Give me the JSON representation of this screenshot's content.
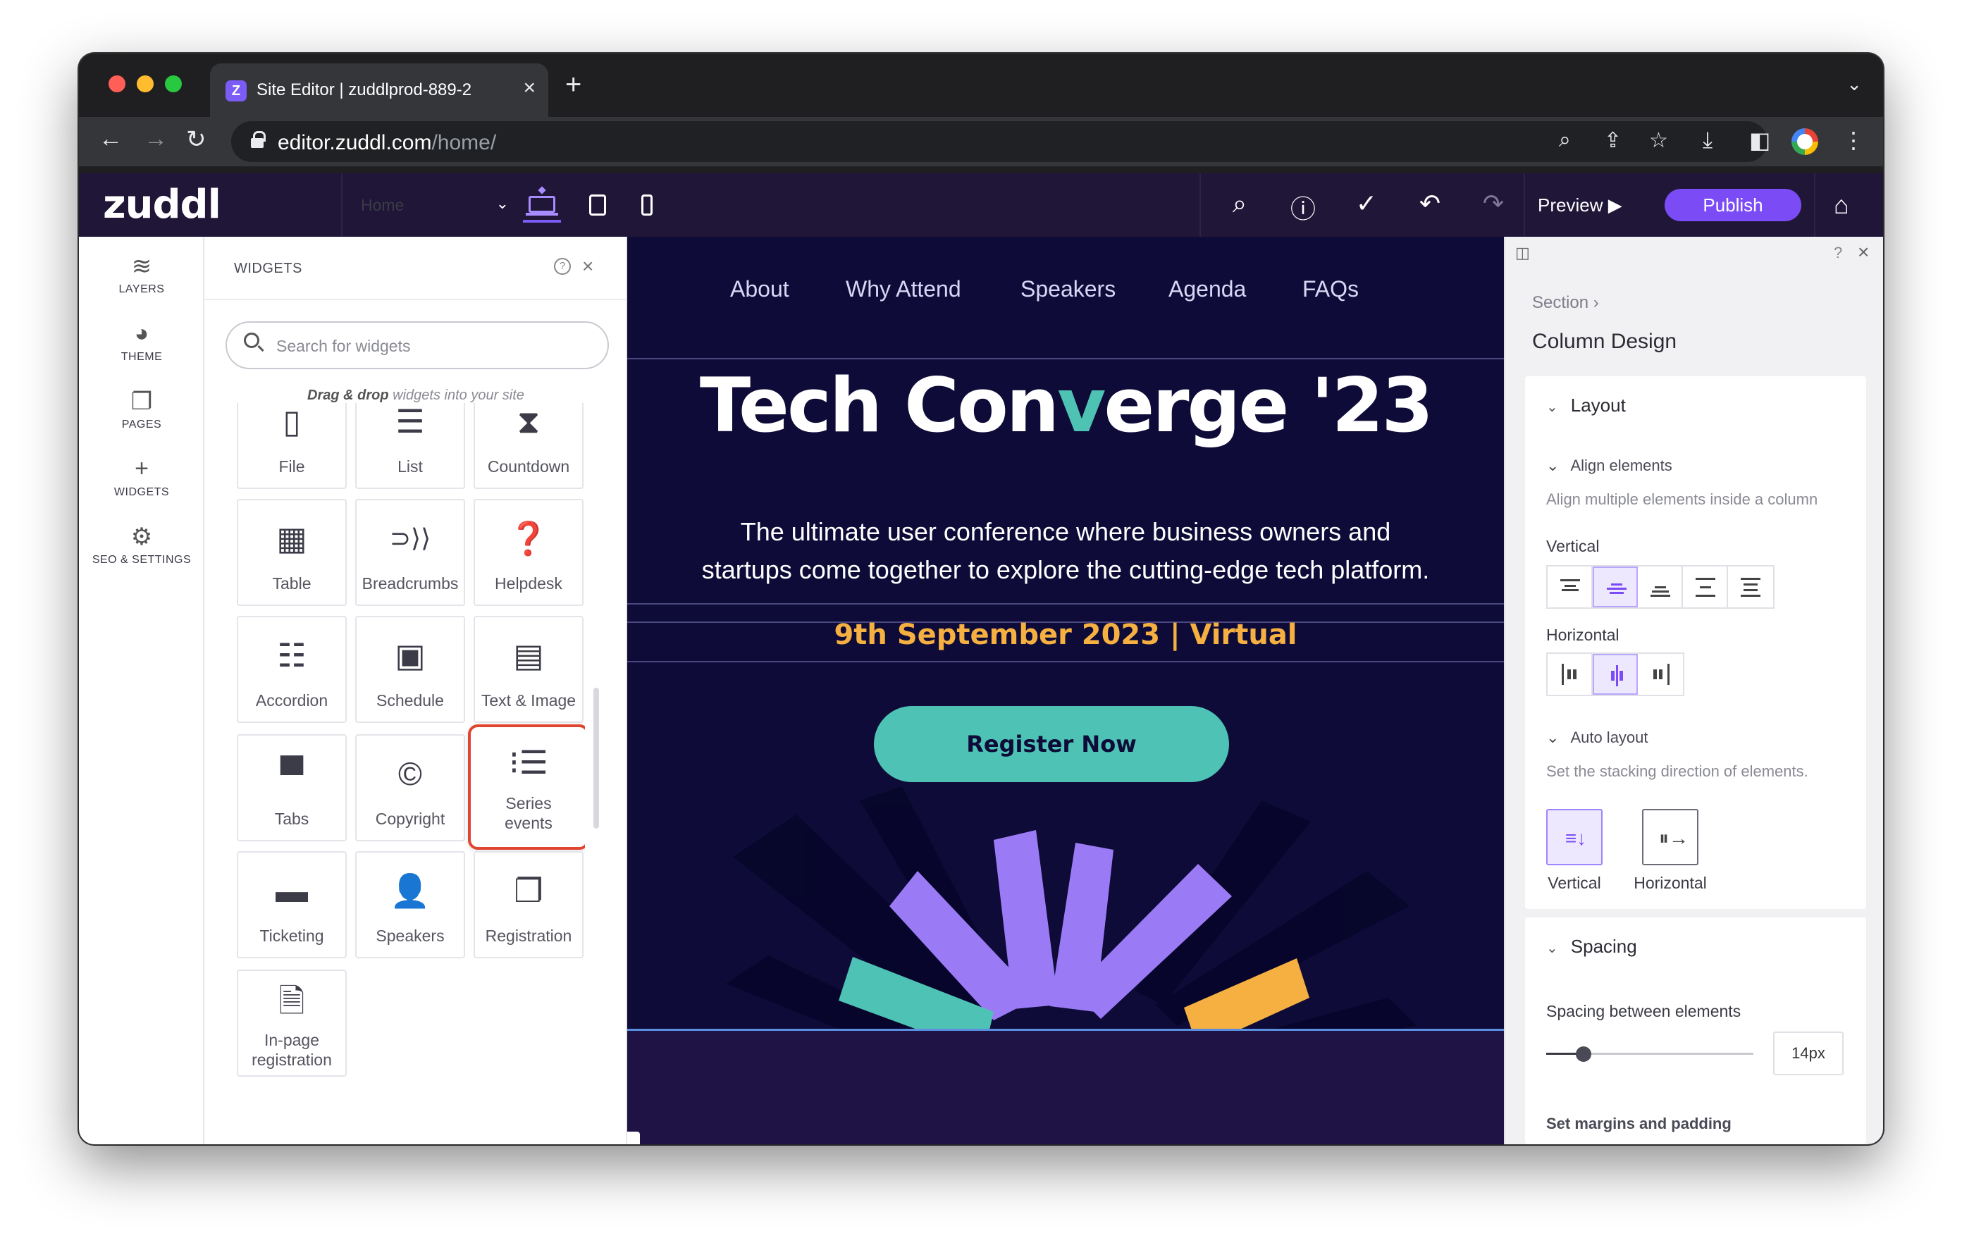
{
  "browser": {
    "tab_title": "Site Editor | zuddlprod-889-2",
    "tab_favicon_letter": "Z",
    "url_domain": "editor.zuddl.com",
    "url_path": "/home/"
  },
  "app": {
    "logo": "zuddl",
    "page_select": "Home",
    "preview_label": "Preview",
    "publish_label": "Publish",
    "accent_color": "#7b4cf5"
  },
  "rail": {
    "items": [
      {
        "icon": "layers-icon",
        "label": "LAYERS"
      },
      {
        "icon": "palette-icon",
        "label": "THEME"
      },
      {
        "icon": "pages-icon",
        "label": "PAGES"
      },
      {
        "icon": "plus-icon",
        "label": "WIDGETS"
      },
      {
        "icon": "gear-icon",
        "label": "SEO & SETTINGS"
      }
    ]
  },
  "widgets_panel": {
    "title": "WIDGETS",
    "search_placeholder": "Search for widgets",
    "hint_bold": "Drag & drop",
    "hint_rest": " widgets into your site",
    "items": [
      {
        "label": "File",
        "icon": "file-icon"
      },
      {
        "label": "List",
        "icon": "list-icon"
      },
      {
        "label": "Countdown",
        "icon": "hourglass-icon"
      },
      {
        "label": "Table",
        "icon": "table-icon"
      },
      {
        "label": "Breadcrumbs",
        "icon": "breadcrumbs-icon"
      },
      {
        "label": "Helpdesk",
        "icon": "help-circle-icon"
      },
      {
        "label": "Accordion",
        "icon": "accordion-icon"
      },
      {
        "label": "Schedule",
        "icon": "calendar-icon"
      },
      {
        "label": "Text & Image",
        "icon": "text-image-icon"
      },
      {
        "label": "Tabs",
        "icon": "tabs-icon"
      },
      {
        "label": "Copyright",
        "icon": "copyright-icon"
      },
      {
        "label": "Series events",
        "icon": "bulleted-list-icon",
        "selected": true
      },
      {
        "label": "Ticketing",
        "icon": "ticket-icon"
      },
      {
        "label": "Speakers",
        "icon": "speaker-icon"
      },
      {
        "label": "Registration",
        "icon": "registration-icon"
      },
      {
        "label": "In-page registration",
        "icon": "document-icon"
      }
    ]
  },
  "canvas": {
    "nav": [
      "About",
      "Why Attend",
      "Speakers",
      "Agenda",
      "FAQs"
    ],
    "title_pre": "Tech Con",
    "title_v": "v",
    "title_post": "erge '23",
    "subtitle": "The ultimate user conference where business owners and startups come together to explore the cutting-edge tech platform.",
    "date": "9th September 2023 | Virtual",
    "cta": "Register Now",
    "colors": {
      "background": "#0e0b38",
      "teal": "#4ec3b5",
      "orange": "#f5b041",
      "violet": "#9b7bf5"
    }
  },
  "properties": {
    "breadcrumb": "Section",
    "title": "Column Design",
    "layout": {
      "heading": "Layout",
      "align_heading": "Align elements",
      "align_desc": "Align multiple elements inside a column",
      "vertical_label": "Vertical",
      "horizontal_label": "Horizontal",
      "auto_layout_heading": "Auto layout",
      "auto_layout_desc": "Set the stacking direction of elements.",
      "direction_vertical": "Vertical",
      "direction_horizontal": "Horizontal"
    },
    "spacing": {
      "heading": "Spacing",
      "between_label": "Spacing between elements",
      "value": "14px",
      "margins_label": "Set margins and padding"
    }
  }
}
